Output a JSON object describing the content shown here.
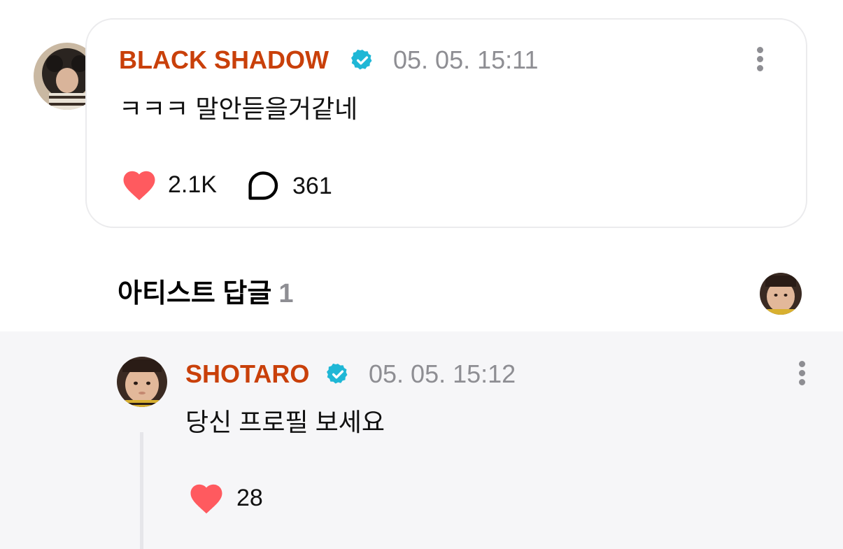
{
  "comment": {
    "username": "BLACK SHADOW",
    "verified_icon": "verified-badge-icon",
    "timestamp": "05. 05. 15:11",
    "text": "ㅋㅋㅋ 말안듣을거같네",
    "likes": "2.1K",
    "replies": "361"
  },
  "artist_replies": {
    "title": "아티스트 답글",
    "count": "1"
  },
  "reply": {
    "username": "SHOTARO",
    "timestamp": "05. 05. 15:12",
    "text": "당신 프로필 보세요",
    "likes": "28"
  },
  "colors": {
    "username": "#c9400a",
    "verified": "#1fb7d6",
    "heart": "#ff5a5f",
    "muted": "#8e8e93",
    "reply_bg": "#f6f6f8"
  }
}
